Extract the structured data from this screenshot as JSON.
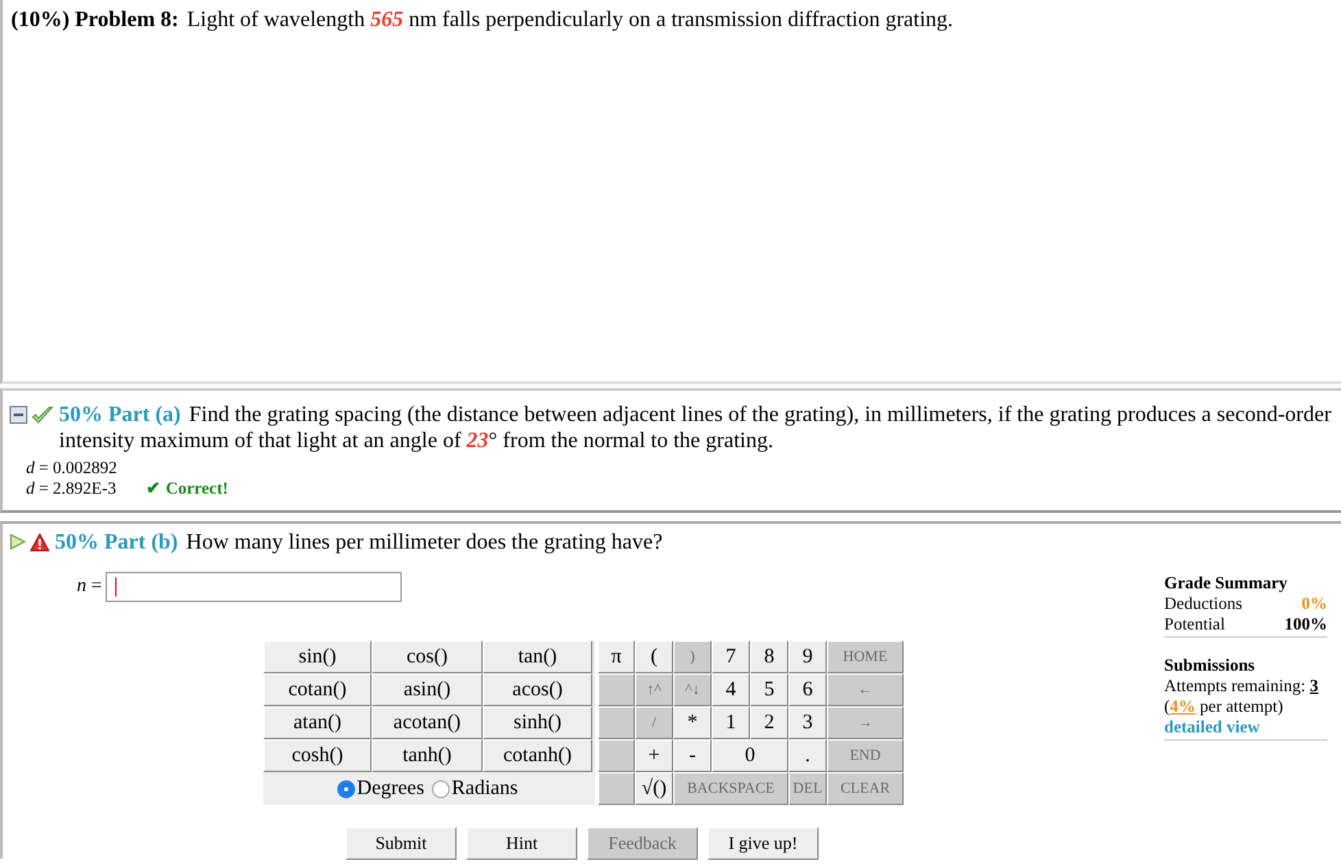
{
  "problem": {
    "percent": "(10%)",
    "label": "Problem 8:",
    "text": "Light of wavelength *565* nm falls perpendicularly on a transmission diffraction grating."
  },
  "parts": [
    {
      "kind": "answered",
      "expanded": true,
      "percent": "50%",
      "label": "Part (a)",
      "text": "Find the grating spacing (the distance between adjacent lines of the grating), in millimeters, if the grating produces a second-order intensity maximum of that light at an angle of *23*° from the normal to the grating.",
      "answers": [
        {
          "text": "*d* = 0.002892"
        },
        {
          "text": "*d* = 2.892E-3",
          "feedback": "✔ Correct!"
        }
      ]
    },
    {
      "kind": "active",
      "expanded": false,
      "percent": "50%",
      "label": "Part (b)",
      "text": "How many lines per millimeter does the grating have?"
    }
  ],
  "input": {
    "label": "*n* ="
  },
  "functions": [
    [
      "sin()",
      "cos()",
      "tan()"
    ],
    [
      "cotan()",
      "asin()",
      "acos()"
    ],
    [
      "atan()",
      "acotan()",
      "sinh()"
    ],
    [
      "cosh()",
      "tanh()",
      "cotanh()"
    ]
  ],
  "angle_modes": [
    {
      "label": "Degrees",
      "selected": true
    },
    {
      "label": "Radians",
      "selected": false
    }
  ],
  "keypad": [
    [
      {
        "kind": "single",
        "label": "π",
        "disabled": false
      },
      {
        "kind": "single",
        "label": "(",
        "disabled": false
      },
      {
        "kind": "single",
        "label": ")",
        "disabled": true
      },
      {
        "kind": "single",
        "label": "7",
        "disabled": false
      },
      {
        "kind": "single",
        "label": "8",
        "disabled": false
      },
      {
        "kind": "single",
        "label": "9",
        "disabled": false
      },
      {
        "kind": "single",
        "label": "HOME",
        "disabled": true
      }
    ],
    [
      {
        "kind": "blank"
      },
      {
        "kind": "single",
        "label": "↑^",
        "disabled": true
      },
      {
        "kind": "single",
        "label": "^↓",
        "disabled": true
      },
      {
        "kind": "single",
        "label": "4",
        "disabled": false
      },
      {
        "kind": "single",
        "label": "5",
        "disabled": false
      },
      {
        "kind": "single",
        "label": "6",
        "disabled": false
      },
      {
        "kind": "single",
        "label": "←",
        "disabled": true
      }
    ],
    [
      {
        "kind": "blank"
      },
      {
        "kind": "single",
        "label": "/",
        "disabled": true
      },
      {
        "kind": "single",
        "label": "*",
        "disabled": false
      },
      {
        "kind": "single",
        "label": "1",
        "disabled": false
      },
      {
        "kind": "single",
        "label": "2",
        "disabled": false
      },
      {
        "kind": "single",
        "label": "3",
        "disabled": false
      },
      {
        "kind": "single",
        "label": "→",
        "disabled": true
      }
    ],
    [
      {
        "kind": "blank"
      },
      {
        "kind": "single",
        "label": "+",
        "disabled": false
      },
      {
        "kind": "single",
        "label": "-",
        "disabled": false
      },
      {
        "kind": "double",
        "label": "0",
        "disabled": false
      },
      {
        "kind": "single",
        "label": ".",
        "disabled": false
      },
      {
        "kind": "single",
        "label": "END",
        "disabled": true
      }
    ],
    [
      {
        "kind": "blank"
      },
      {
        "kind": "single",
        "label": "√()",
        "disabled": false
      },
      {
        "kind": "triple",
        "label": "BACKSPACE",
        "disabled": true
      },
      {
        "kind": "single",
        "label": "DEL",
        "disabled": true
      },
      {
        "kind": "single",
        "label": "CLEAR",
        "disabled": true
      }
    ]
  ],
  "buttons": [
    {
      "label": "Submit",
      "disabled": false
    },
    {
      "label": "Hint",
      "disabled": false
    },
    {
      "label": "Feedback",
      "disabled": true
    },
    {
      "label": "I give up!",
      "disabled": false
    }
  ],
  "grade_summary": {
    "title": "Grade Summary",
    "rows": [
      {
        "label": "Deductions",
        "value": "0%",
        "kind": "deduction"
      },
      {
        "label": "Potential",
        "value": "100%",
        "kind": "potential"
      }
    ]
  },
  "submissions": {
    "title": "Submissions",
    "attempts_label": "Attempts remaining:",
    "attempts": "3",
    "penalty": "(**4%** per attempt)",
    "link": "detailed view"
  }
}
